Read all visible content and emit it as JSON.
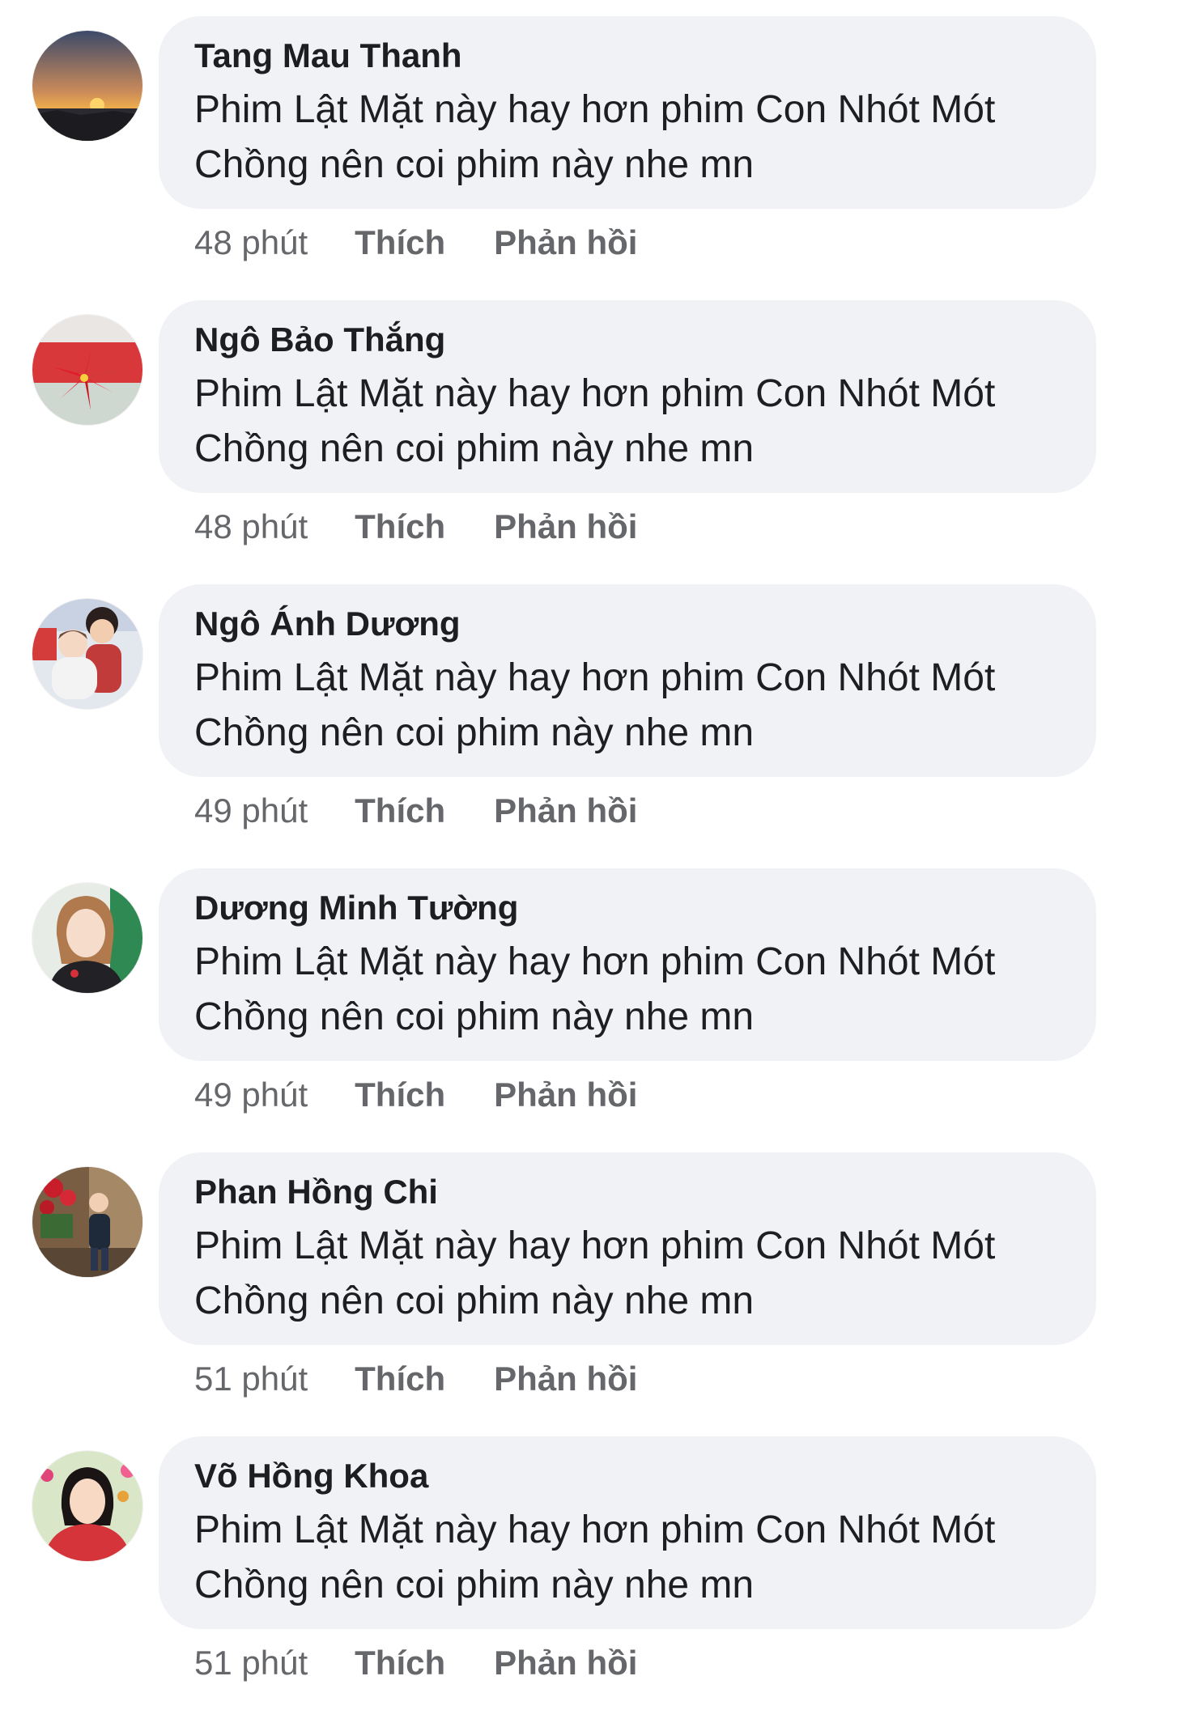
{
  "actions": {
    "like_label": "Thích",
    "reply_label": "Phản hồi"
  },
  "comments": [
    {
      "author": "Tang Mau Thanh",
      "line1": "Phim Lật Mặt này hay hơn phim Con Nhót Mót",
      "line2": "Chồng nên coi phim này nhe mn",
      "time": "48 phút",
      "avatar": "sunset-avatar"
    },
    {
      "author": "Ngô Bảo Thắng",
      "line1": "Phim Lật Mặt này hay hơn phim Con Nhót Mót",
      "line2": "Chồng nên coi phim này nhe mn",
      "time": "48 phút",
      "avatar": "poinsettia-avatar"
    },
    {
      "author": "Ngô Ánh Dương",
      "line1": "Phim Lật Mặt này hay hơn phim Con Nhót Mót",
      "line2": "Chồng nên coi phim này nhe mn",
      "time": "49 phút",
      "avatar": "children-avatar"
    },
    {
      "author": "Dương Minh Tường",
      "line1": "Phim Lật Mặt này hay hơn phim Con Nhót Mót",
      "line2": "Chồng nên coi phim này nhe mn",
      "time": "49 phút",
      "avatar": "woman-avatar"
    },
    {
      "author": "Phan Hồng Chi",
      "line1": "Phim Lật Mặt này hay hơn phim Con Nhót Mót",
      "line2": "Chồng nên coi phim này nhe mn",
      "time": "51 phút",
      "avatar": "boy-flowers-avatar"
    },
    {
      "author": "Võ Hồng Khoa",
      "line1": "Phim Lật Mặt này hay hơn phim Con Nhót Mót",
      "line2": "Chồng nên coi phim này nhe mn",
      "time": "51 phút",
      "avatar": "woman-red-avatar"
    }
  ]
}
